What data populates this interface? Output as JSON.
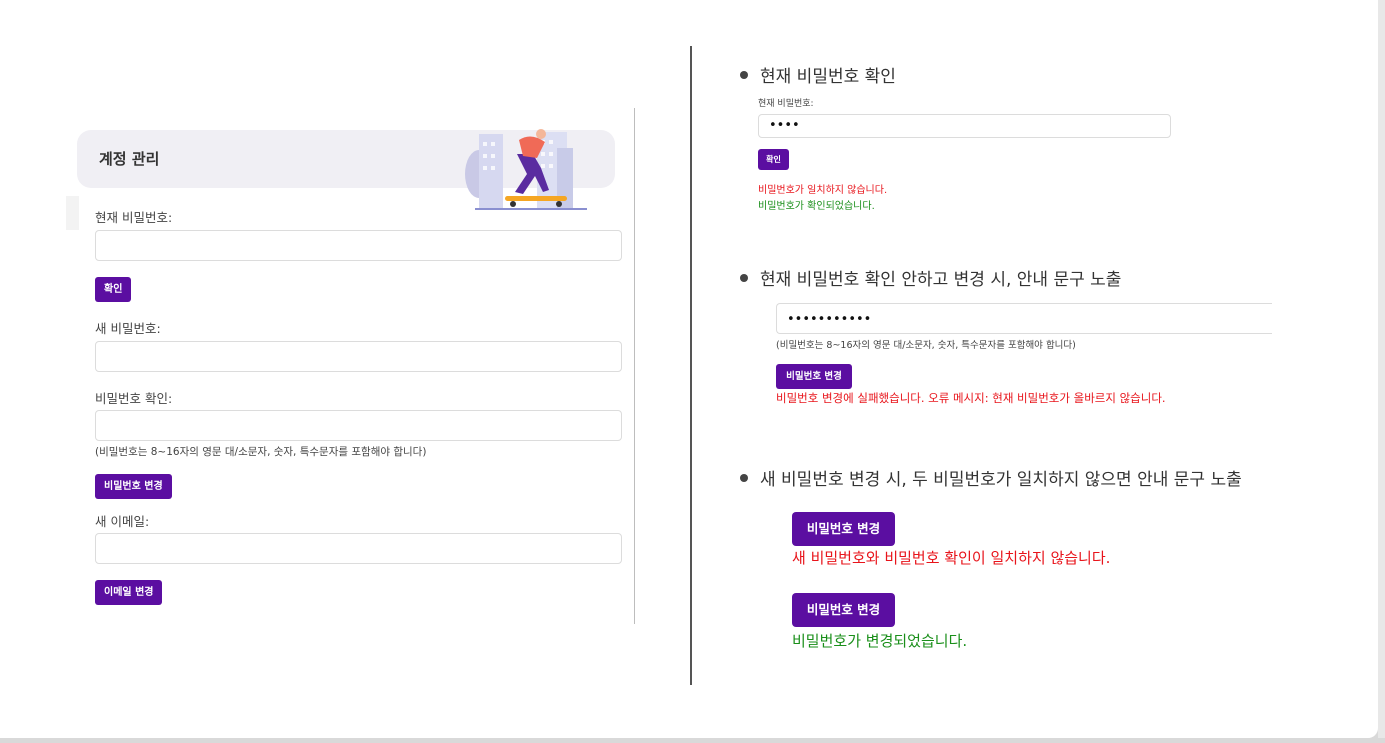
{
  "left_panel": {
    "header_title": "계정 관리",
    "current_pw_label": "현재 비밀번호:",
    "confirm_btn": "확인",
    "new_pw_label": "새 비밀번호:",
    "pw_confirm_label": "비밀번호 확인:",
    "pw_hint": "(비밀번호는 8~16자의 영문 대/소문자, 숫자, 특수문자를 포함해야 합니다)",
    "change_pw_btn": "비밀번호 변경",
    "new_email_label": "새 이메일:",
    "change_email_btn": "이메일 변경"
  },
  "right_panel": {
    "section1": {
      "title": "현재 비밀번호 확인",
      "label": "현재 비밀번호:",
      "input_value": "••••",
      "btn": "확인",
      "error": "비밀번호가 일치하지 않습니다.",
      "success": "비밀번호가 확인되었습니다."
    },
    "section2": {
      "title": "현재 비밀번호 확인 안하고 변경 시, 안내 문구 노출",
      "input_value": "•••••••••••",
      "hint": "(비밀번호는 8~16자의 영문 대/소문자, 숫자, 특수문자를 포함해야 합니다)",
      "btn": "비밀번호 변경",
      "error": "비밀번호 변경에 실패했습니다. 오류 메시지: 현재 비밀번호가 올바르지 않습니다."
    },
    "section3": {
      "title": "새 비밀번호 변경 시, 두 비밀번호가 일치하지 않으면 안내 문구 노출",
      "btn1": "비밀번호 변경",
      "error": "새 비밀번호와 비밀번호 확인이 일치하지 않습니다.",
      "btn2": "비밀번호 변경",
      "success": "비밀번호가 변경되었습니다."
    }
  },
  "colors": {
    "accent": "#5b0ea1",
    "error": "#e8141b",
    "success": "#1a8f1a"
  }
}
